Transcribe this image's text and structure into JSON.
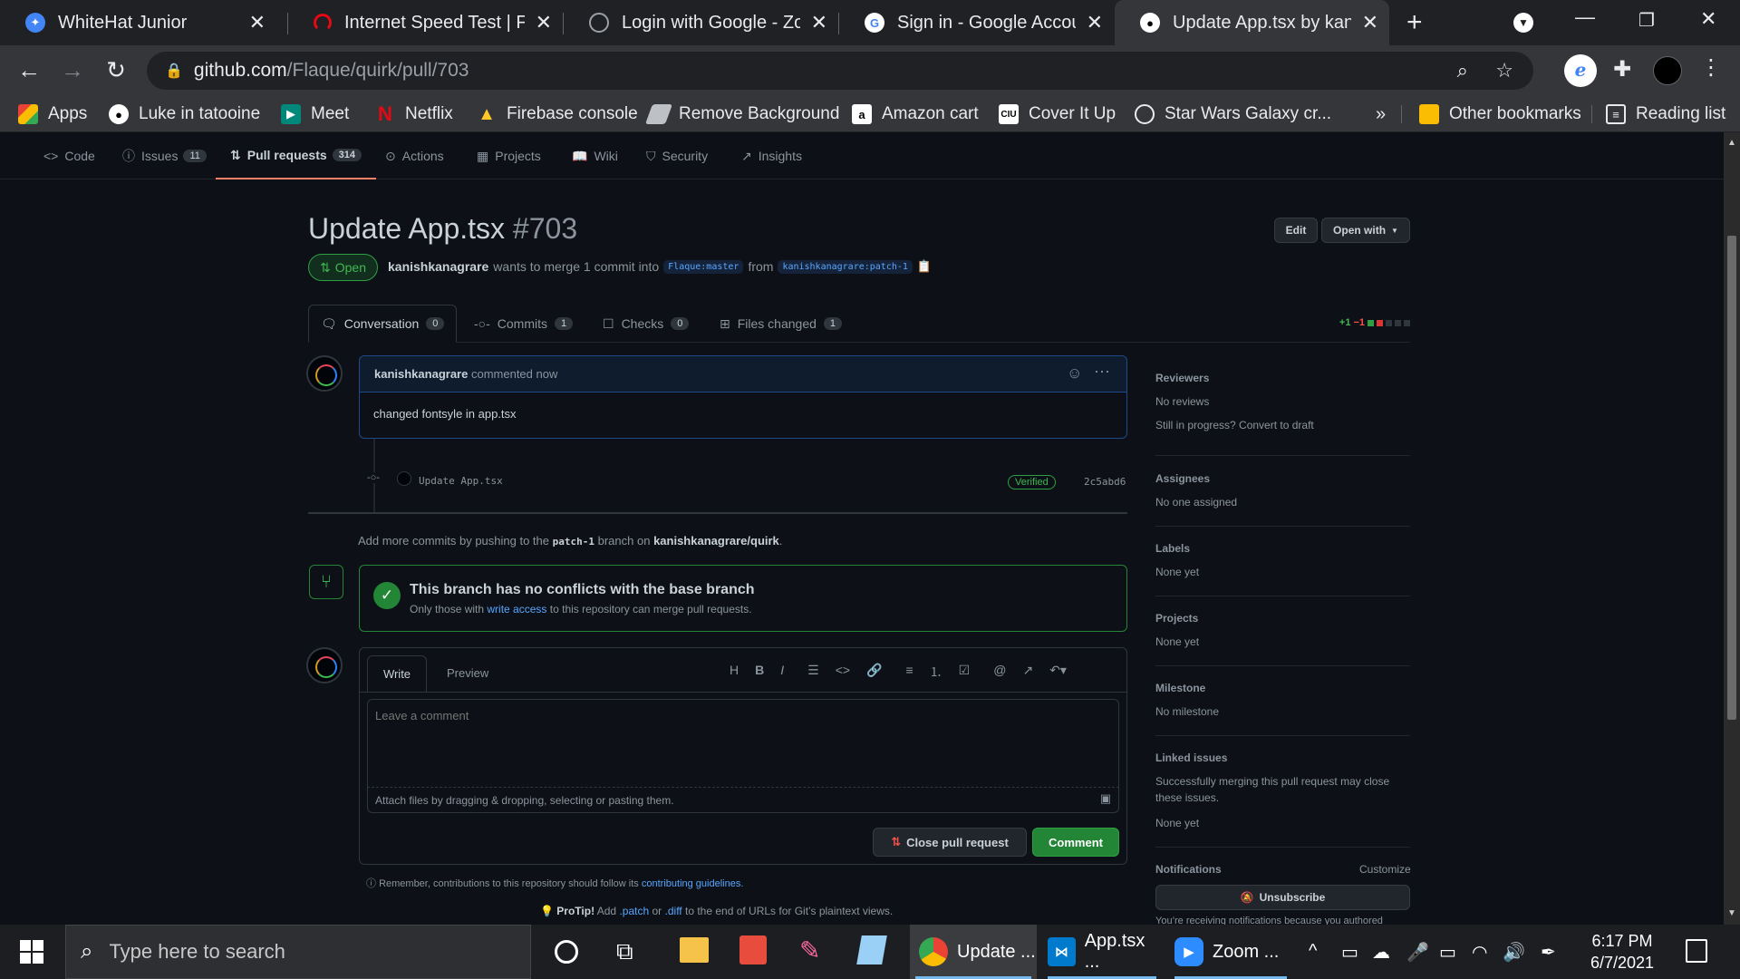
{
  "browser": {
    "tabs": [
      {
        "title": "WhiteHat Junior",
        "active": false
      },
      {
        "title": "Internet Speed Test | Fast.c",
        "active": false
      },
      {
        "title": "Login with Google - Zoom",
        "active": false
      },
      {
        "title": "Sign in - Google Accounts",
        "active": false
      },
      {
        "title": "Update App.tsx by kanishk",
        "active": true
      }
    ],
    "url_host": "github.com",
    "url_path": "/Flaque/quirk/pull/703",
    "bookmarks": [
      {
        "label": "Apps",
        "icon": "apps-grid-icon"
      },
      {
        "label": "Luke in tatooine",
        "icon": "github-icon"
      },
      {
        "label": "Meet",
        "icon": "meet-icon"
      },
      {
        "label": "Netflix",
        "icon": "netflix-icon"
      },
      {
        "label": "Firebase console",
        "icon": "firebase-icon"
      },
      {
        "label": "Remove Background",
        "icon": "remove-bg-icon"
      },
      {
        "label": "Amazon cart",
        "icon": "amazon-icon"
      },
      {
        "label": "Cover It Up",
        "icon": "cover-it-up-icon"
      },
      {
        "label": "Star Wars Galaxy cr...",
        "icon": "star-wars-icon"
      }
    ],
    "more_bookmarks": "»",
    "other_bookmarks": "Other bookmarks",
    "reading_list": "Reading list"
  },
  "repo_nav": [
    {
      "label": "Code",
      "icon": "code-icon",
      "count": null
    },
    {
      "label": "Issues",
      "icon": "issue-icon",
      "count": "11"
    },
    {
      "label": "Pull requests",
      "icon": "pull-request-icon",
      "count": "314"
    },
    {
      "label": "Actions",
      "icon": "actions-icon",
      "count": null
    },
    {
      "label": "Projects",
      "icon": "projects-icon",
      "count": null
    },
    {
      "label": "Wiki",
      "icon": "wiki-icon",
      "count": null
    },
    {
      "label": "Security",
      "icon": "shield-icon",
      "count": null
    },
    {
      "label": "Insights",
      "icon": "graph-icon",
      "count": null
    }
  ],
  "pr": {
    "title": "Update App.tsx",
    "number": "#703",
    "edit_label": "Edit",
    "open_with_label": "Open with",
    "state": "Open",
    "author": "kanishkanagrare",
    "merge_text": "wants to merge 1 commit into",
    "base_ref": "Flaque:master",
    "from_text": "from",
    "head_ref": "kanishkanagrare:patch-1",
    "tabs": [
      {
        "label": "Conversation",
        "count": "0"
      },
      {
        "label": "Commits",
        "count": "1"
      },
      {
        "label": "Checks",
        "count": "0"
      },
      {
        "label": "Files changed",
        "count": "1"
      }
    ],
    "diff_add": "+1",
    "diff_del": "−1"
  },
  "comment": {
    "author": "kanishkanagrare",
    "meta": "commented now",
    "body": "changed fontsyle in app.tsx"
  },
  "commit": {
    "message": "Update App.tsx",
    "verified": "Verified",
    "sha": "2c5abd6"
  },
  "push_hint": {
    "prefix": "Add more commits by pushing to the",
    "branch": "patch-1",
    "middle": "branch on",
    "repo": "kanishkanagrare/quirk",
    "suffix": "."
  },
  "merge_box": {
    "title": "This branch has no conflicts with the base branch",
    "sub_prefix": "Only those with",
    "sub_link": "write access",
    "sub_suffix": "to this repository can merge pull requests."
  },
  "editor": {
    "write_tab": "Write",
    "preview_tab": "Preview",
    "placeholder": "Leave a comment",
    "attach_hint": "Attach files by dragging & dropping, selecting or pasting them.",
    "close_pr": "Close pull request",
    "comment_btn": "Comment"
  },
  "guidelines": {
    "prefix": "Remember, contributions to this repository should follow its",
    "link": "contributing guidelines",
    "suffix": "."
  },
  "protip": {
    "bold": "ProTip!",
    "t1": "Add",
    "patch": ".patch",
    "t2": "or",
    "diff": ".diff",
    "t3": "to the end of URLs for Git’s plaintext views."
  },
  "sidebar": {
    "reviewers_h": "Reviewers",
    "reviewers_v": "No reviews",
    "draft_hint": "Still in progress? Convert to draft",
    "assignees_h": "Assignees",
    "assignees_v": "No one assigned",
    "labels_h": "Labels",
    "labels_v": "None yet",
    "projects_h": "Projects",
    "projects_v": "None yet",
    "milestone_h": "Milestone",
    "milestone_v": "No milestone",
    "linked_h": "Linked issues",
    "linked_d1": "Successfully merging this pull request may close",
    "linked_d2": "these issues.",
    "linked_v": "None yet",
    "notif_h": "Notifications",
    "customize": "Customize",
    "unsubscribe": "Unsubscribe",
    "notif_hint": "You’re receiving notifications because you authored"
  },
  "taskbar": {
    "search_placeholder": "Type here to search",
    "apps": [
      {
        "label": "Update ...",
        "icon": "chrome-icon"
      },
      {
        "label": "App.tsx ...",
        "icon": "vscode-icon"
      },
      {
        "label": "Zoom ...",
        "icon": "zoom-icon"
      }
    ],
    "time": "6:17 PM",
    "date": "6/7/2021"
  },
  "colors": {
    "accent_orange": "#f78166",
    "success_green": "#238636",
    "link_blue": "#58a6ff",
    "danger_red": "#f85149"
  }
}
